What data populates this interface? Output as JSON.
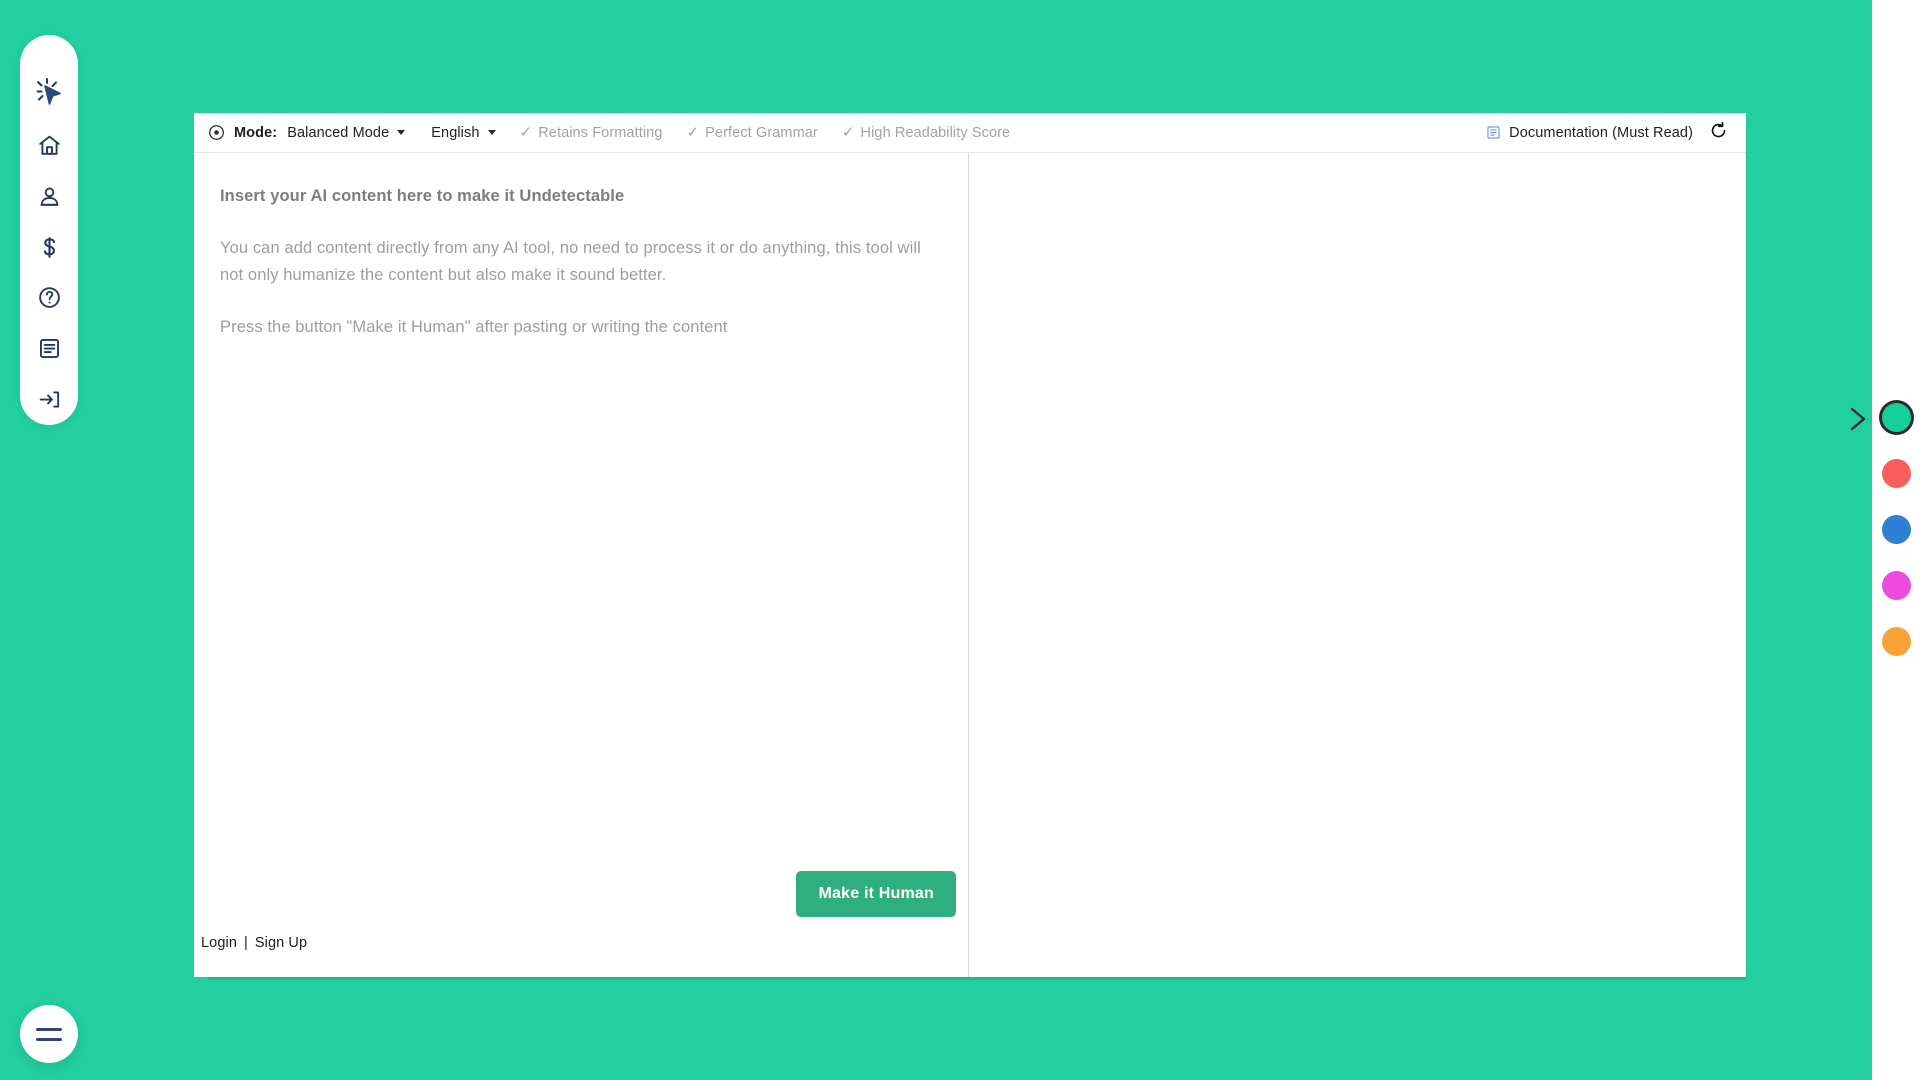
{
  "theme": {
    "background_green": "#22cfa0",
    "shadow_green": "#1fba91",
    "button_green": "#2fae7f",
    "sidebar_icon_navy": "#1f3864"
  },
  "sidebar": {
    "logo": {
      "icon": "cursor-click-icon",
      "name": "app-logo"
    },
    "items": [
      {
        "icon": "home-icon",
        "label": "Home"
      },
      {
        "icon": "user-icon",
        "label": "Account"
      },
      {
        "icon": "dollar-icon",
        "label": "Pricing"
      },
      {
        "icon": "question-circle-icon",
        "label": "Help"
      },
      {
        "icon": "document-icon",
        "label": "Documentation"
      },
      {
        "icon": "login-arrow-icon",
        "label": "Login"
      }
    ],
    "menu_button": {
      "icon": "hamburger-icon",
      "label": "Menu"
    }
  },
  "toolbar": {
    "target_icon": "target-icon",
    "mode_label": "Mode:",
    "mode_value": "Balanced Mode",
    "language_value": "English",
    "features": [
      "Retains Formatting",
      "Perfect Grammar",
      "High Readability Score"
    ],
    "documentation_label": "Documentation (Must Read)",
    "documentation_icon": "document-blue-icon",
    "refresh_icon": "refresh-icon"
  },
  "editor": {
    "placeholder_heading": "Insert your AI content here to make it Undetectable",
    "placeholder_paragraph_1": "You can add content directly from any AI tool, no need to process it or do anything, this tool will not only humanize the content but also make it sound better.",
    "placeholder_paragraph_2": "Press the button \"Make it Human\" after pasting or writing the content",
    "output_placeholder": ""
  },
  "actions": {
    "make_human_label": "Make it Human",
    "login_label": "Login",
    "separator": "|",
    "signup_label": "Sign Up"
  },
  "color_rail": {
    "toggle_icon": "chevron-right-icon",
    "swatches": [
      {
        "name": "green",
        "hex": "#16cf9a",
        "selected": true
      },
      {
        "name": "red",
        "hex": "#fb5c5c",
        "selected": false
      },
      {
        "name": "blue",
        "hex": "#2f7fd4",
        "selected": false
      },
      {
        "name": "magenta",
        "hex": "#ef4ae0",
        "selected": false
      },
      {
        "name": "orange",
        "hex": "#f9a238",
        "selected": false
      }
    ]
  }
}
